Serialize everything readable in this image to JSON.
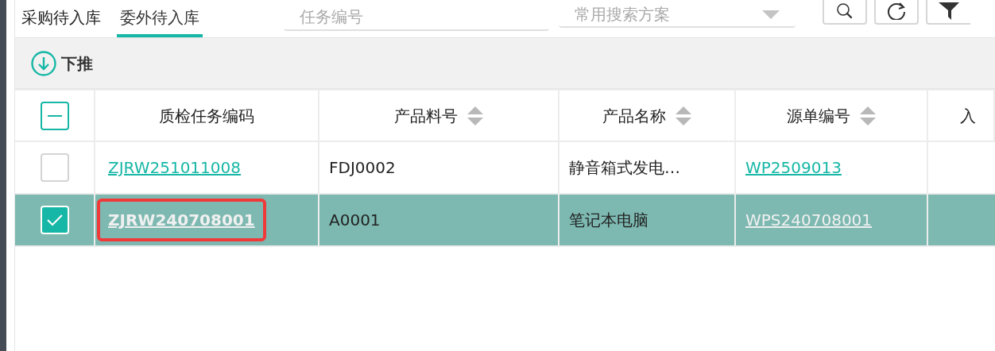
{
  "tabs": [
    {
      "label": "采购待入库",
      "selected": false
    },
    {
      "label": "委外待入库",
      "selected": true
    }
  ],
  "search": {
    "placeholder": "任务编号"
  },
  "scheme_select": {
    "placeholder": "常用搜索方案"
  },
  "toolbar": {
    "push_down": "下推"
  },
  "table": {
    "select_all_partial": true,
    "columns": [
      {
        "label": "质检任务编码",
        "sortable": false
      },
      {
        "label": "产品料号",
        "sortable": true
      },
      {
        "label": "产品名称",
        "sortable": true
      },
      {
        "label": "源单编号",
        "sortable": true
      },
      {
        "label": "入",
        "sortable": false
      }
    ],
    "rows": [
      {
        "selected": false,
        "task_code": "ZJRW251011008",
        "annotated": false,
        "part_no": "FDJ0002",
        "product_name": "静音箱式发电…",
        "source_no": "WP2509013"
      },
      {
        "selected": true,
        "task_code": "ZJRW240708001",
        "annotated": true,
        "part_no": "A0001",
        "product_name": "笔记本电脑",
        "source_no": "WPS240708001"
      }
    ]
  }
}
